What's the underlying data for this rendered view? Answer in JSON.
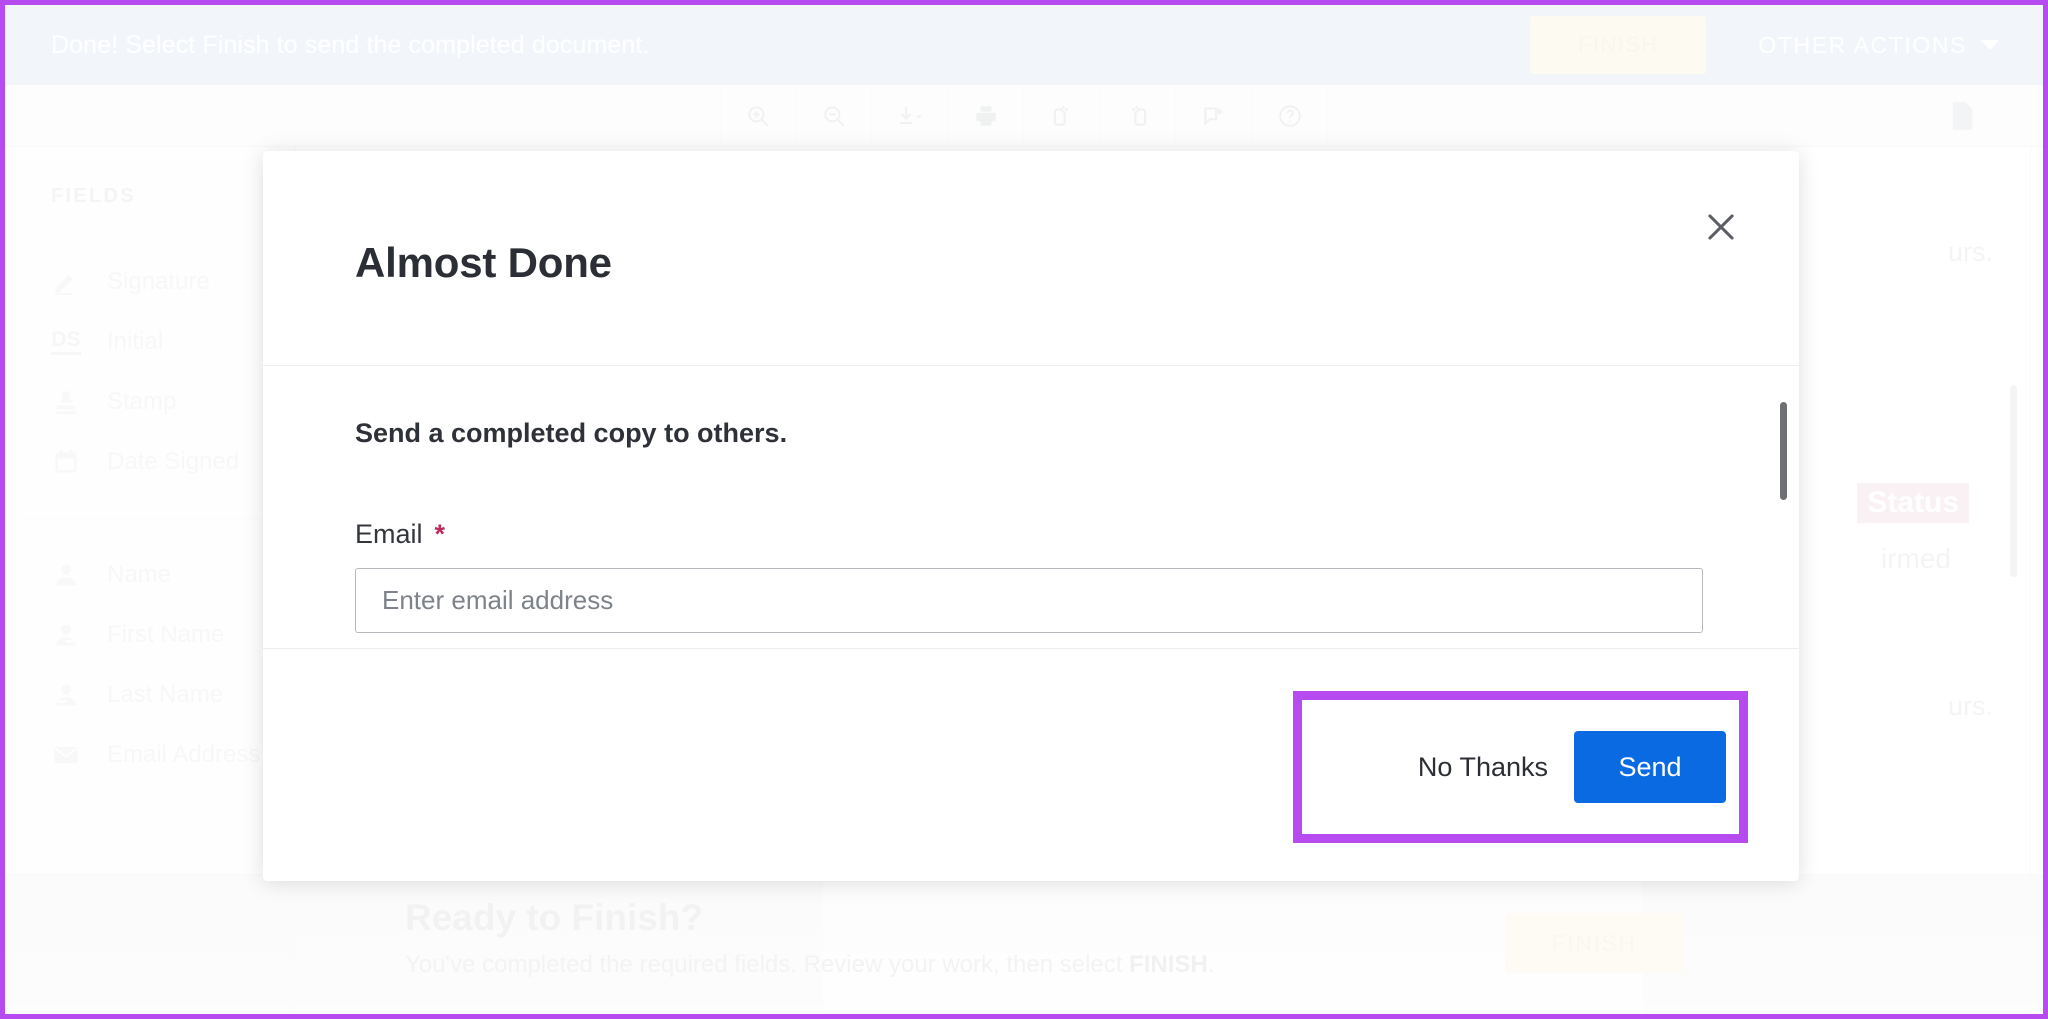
{
  "banner": {
    "message": "Done! Select Finish to send the completed document.",
    "finish_label": "FINISH",
    "other_actions_label": "OTHER ACTIONS",
    "background_color": "#e3eaf3",
    "finish_bg_color": "#fbf6e0"
  },
  "toolbar": {
    "tools": [
      {
        "name": "zoom-in-icon",
        "title": "Zoom In"
      },
      {
        "name": "zoom-out-icon",
        "title": "Zoom Out"
      },
      {
        "name": "download-icon",
        "title": "Download"
      },
      {
        "name": "print-icon",
        "title": "Print"
      },
      {
        "name": "rotate-left-icon",
        "title": "Rotate Left"
      },
      {
        "name": "rotate-right-icon",
        "title": "Rotate Right"
      },
      {
        "name": "add-comment-icon",
        "title": "Add Comment"
      },
      {
        "name": "help-icon",
        "title": "Help"
      }
    ],
    "document_icon": "document-page-icon"
  },
  "sidebar": {
    "title": "FIELDS",
    "group_one": [
      {
        "label": "Signature",
        "icon": "pen-signature-icon"
      },
      {
        "label": "Initial",
        "icon": "ds-initial-icon"
      },
      {
        "label": "Stamp",
        "icon": "stamp-icon"
      },
      {
        "label": "Date Signed",
        "icon": "calendar-icon"
      }
    ],
    "group_two": [
      {
        "label": "Name",
        "icon": "person-icon"
      },
      {
        "label": "First Name",
        "icon": "person-first-icon"
      },
      {
        "label": "Last Name",
        "icon": "person-last-icon"
      },
      {
        "label": "Email Address",
        "icon": "envelope-icon"
      }
    ],
    "ds_glyph": "DS"
  },
  "document": {
    "fragment_hours_top": "urs.",
    "fragment_hours_bottom": "urs.",
    "status_badge": "Status",
    "fragment_confirmed": "irmed"
  },
  "ready_bar": {
    "title": "Ready to Finish?",
    "subtitle_before": "You've completed the required fields. Review your work, then select ",
    "subtitle_emphasis": "FINISH",
    "subtitle_after": ".",
    "finish_label": "FINISH"
  },
  "modal": {
    "title": "Almost Done",
    "close_icon": "close-x-icon",
    "body_heading": "Send a completed copy to others.",
    "email_label": "Email",
    "required_marker": "*",
    "email_value": "",
    "email_placeholder": "Enter email address",
    "no_thanks_label": "No Thanks",
    "send_label": "Send",
    "send_button_color": "#0a6ae1",
    "required_marker_color": "#c0295b"
  },
  "annotation": {
    "highlight_color": "#b64cf0",
    "frame_color": "#b64cf0"
  }
}
